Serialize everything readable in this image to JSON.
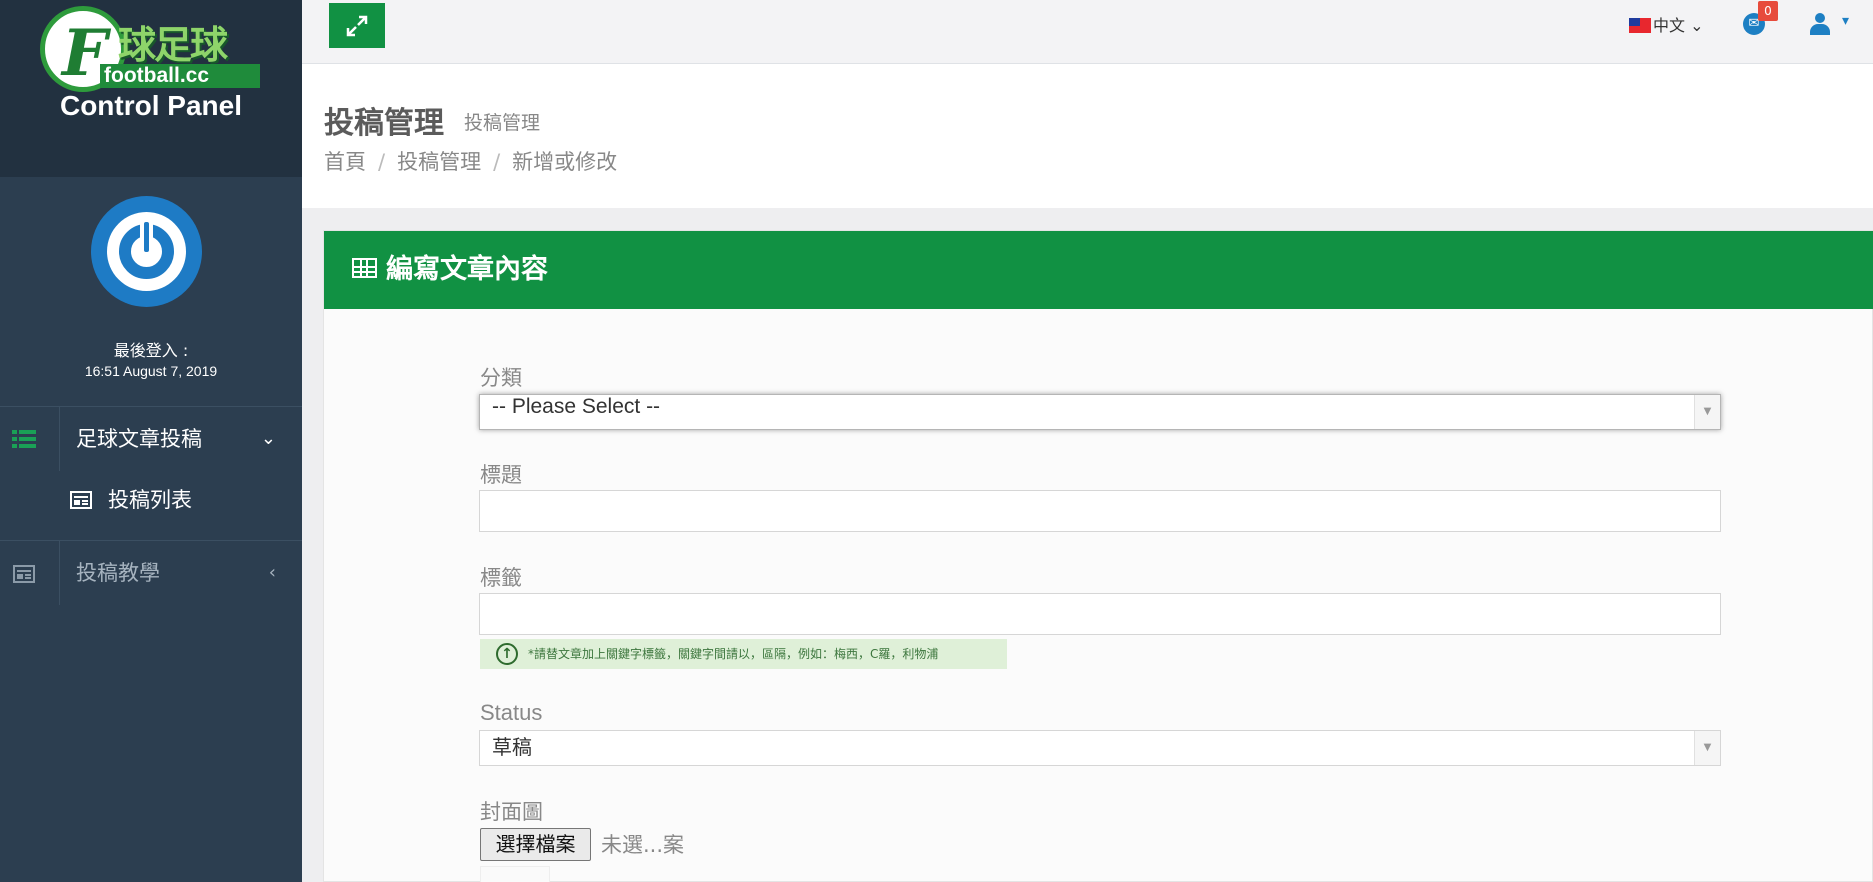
{
  "logo": {
    "brand_chinese": "球足球",
    "brand_f": "F",
    "brand_sub": "football.cc",
    "caption": "Control Panel"
  },
  "user": {
    "last_login_label": "最後登入 :",
    "last_login_time": "16:51 August 7, 2019"
  },
  "sidebar": {
    "items": [
      {
        "label": "足球文章投稿",
        "icon": "list-icon",
        "caret": "⌄",
        "expanded": true
      },
      {
        "label": "投稿列表",
        "icon": "newspaper-icon"
      },
      {
        "label": "投稿教學",
        "icon": "newspaper-icon",
        "caret": "‹",
        "expanded": false
      }
    ]
  },
  "topbar": {
    "language": "中文",
    "language_caret": "⌄",
    "mail_badge": "0",
    "user_caret": "▾",
    "accent": "#119143"
  },
  "header": {
    "title": "投稿管理",
    "subtitle": "投稿管理",
    "breadcrumb": [
      "首頁",
      "投稿管理",
      "新增或修改"
    ],
    "breadcrumb_sep": "/"
  },
  "panel": {
    "title": "編寫文章內容",
    "header_color": "#119143"
  },
  "form": {
    "category_label": "分類",
    "category_value": "-- Please Select --",
    "title_label": "標題",
    "title_value": "",
    "tags_label": "標籤",
    "tags_value": "",
    "tags_hint": "*請替文章加上關鍵字標籤，關鍵字間請以，區隔，例如：梅西，C羅，利物浦",
    "status_label": "Status",
    "status_value": "草稿",
    "cover_label": "封面圖",
    "file_button": "選擇檔案",
    "file_status": "未選...案",
    "select_arrow": "▼"
  }
}
